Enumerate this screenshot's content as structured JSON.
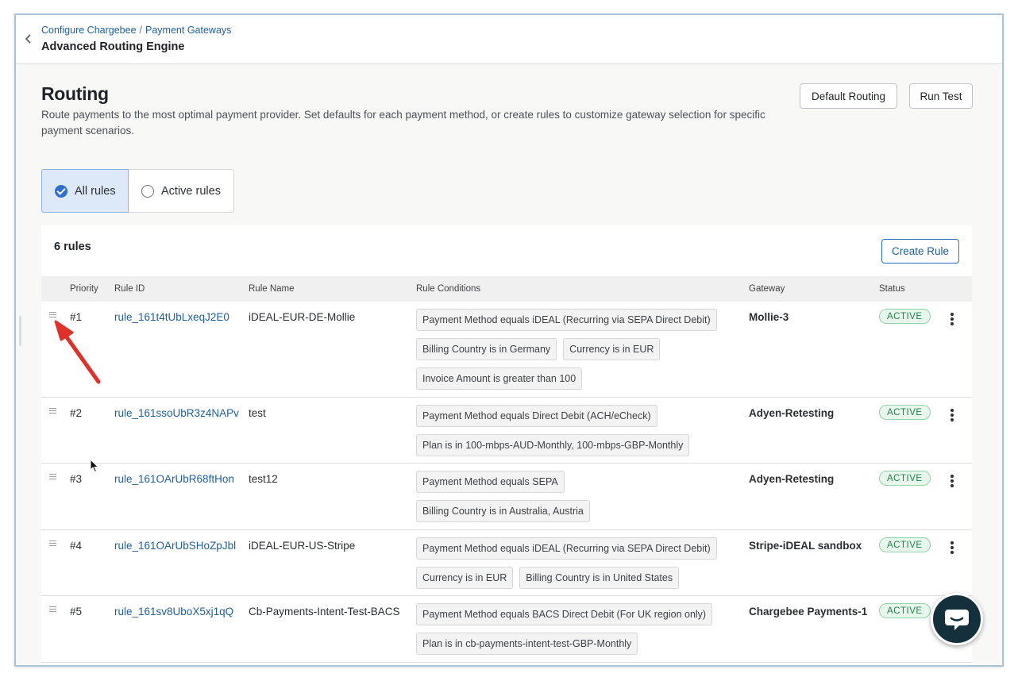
{
  "breadcrumb": {
    "parent": "Configure Chargebee",
    "separator": "/",
    "current": "Payment Gateways"
  },
  "app_title": "Advanced Routing Engine",
  "page": {
    "title": "Routing",
    "description": "Route payments to the most optimal payment provider. Set defaults for each payment method, or create rules to customize gateway selection for specific payment scenarios."
  },
  "header_buttons": {
    "default_routing": "Default Routing",
    "run_test": "Run Test"
  },
  "filter": {
    "all_rules": "All rules",
    "active_rules": "Active rules",
    "selected": "All rules"
  },
  "rules_count": "6 rules",
  "create_rule": "Create Rule",
  "columns": {
    "priority": "Priority",
    "rule_id": "Rule ID",
    "rule_name": "Rule Name",
    "rule_conditions": "Rule Conditions",
    "gateway": "Gateway",
    "status": "Status"
  },
  "rows": [
    {
      "priority": "#1",
      "rule_id": "rule_161t4tUbLxeqJ2E0",
      "rule_name": "iDEAL-EUR-DE-Mollie",
      "conditions": [
        "Payment Method equals iDEAL (Recurring via SEPA Direct Debit)",
        "Billing Country is in Germany",
        "Currency is in EUR",
        "Invoice Amount is greater than 100"
      ],
      "gateway": "Mollie-3",
      "status": "ACTIVE"
    },
    {
      "priority": "#2",
      "rule_id": "rule_161ssoUbR3z4NAPv",
      "rule_name": "test",
      "conditions": [
        "Payment Method equals Direct Debit (ACH/eCheck)",
        "Plan is in 100-mbps-AUD-Monthly, 100-mbps-GBP-Monthly"
      ],
      "gateway": "Adyen-Retesting",
      "status": "ACTIVE"
    },
    {
      "priority": "#3",
      "rule_id": "rule_161OArUbR68ftHon",
      "rule_name": "test12",
      "conditions": [
        "Payment Method equals SEPA",
        "Billing Country is in Australia, Austria"
      ],
      "gateway": "Adyen-Retesting",
      "status": "ACTIVE"
    },
    {
      "priority": "#4",
      "rule_id": "rule_161OArUbSHoZpJbl",
      "rule_name": "iDEAL-EUR-US-Stripe",
      "conditions": [
        "Payment Method equals iDEAL (Recurring via SEPA Direct Debit)",
        "Currency is in EUR",
        "Billing Country is in United States"
      ],
      "gateway": "Stripe-iDEAL sandbox",
      "status": "ACTIVE"
    },
    {
      "priority": "#5",
      "rule_id": "rule_161sv8UboX5xj1qQ",
      "rule_name": "Cb-Payments-Intent-Test-BACS",
      "conditions": [
        "Payment Method equals BACS Direct Debit (For UK region only)",
        "Plan is in cb-payments-intent-test-GBP-Monthly"
      ],
      "gateway": "Chargebee Payments-1",
      "status": "ACTIVE"
    }
  ],
  "icons": {
    "back": "chevron-left-icon",
    "drag": "drag-handle-icon",
    "more": "kebab-menu-icon",
    "chat": "chat-bubble-icon",
    "annotation": "red-arrow-icon"
  },
  "colors": {
    "link": "#1f5fa0",
    "selected_bg": "#dde9f8",
    "check": "#2f6fd4",
    "status_green": "#20824b",
    "annotation_red": "#e0302a",
    "chat_bg": "#15303d"
  }
}
